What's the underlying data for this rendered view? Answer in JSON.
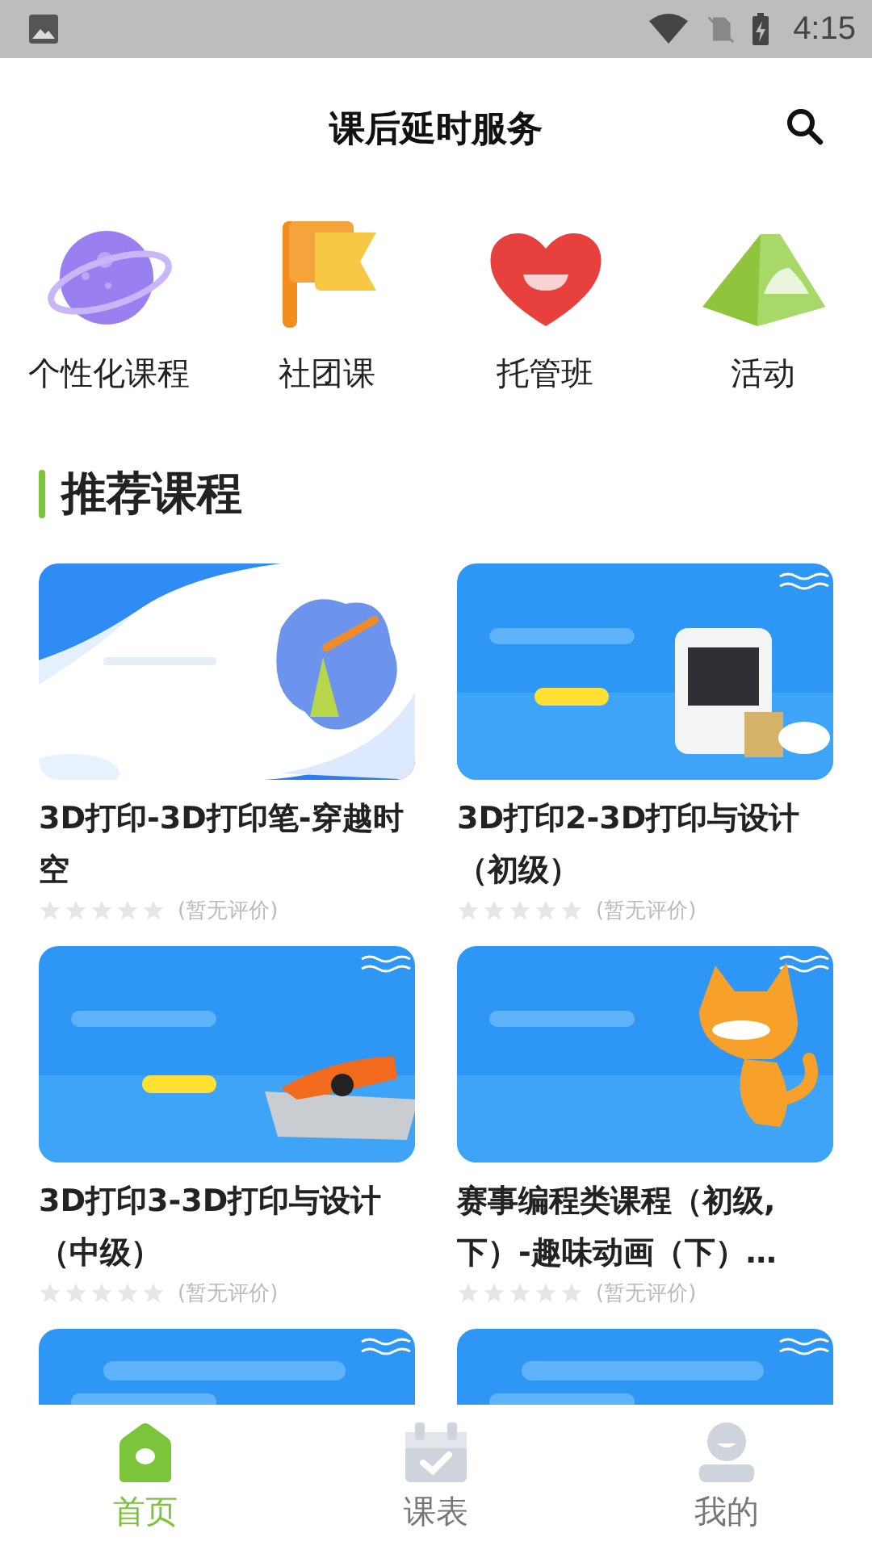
{
  "status_bar": {
    "time": "4:15"
  },
  "header": {
    "title": "课后延时服务"
  },
  "categories": [
    {
      "kind": "planet",
      "label": "个性化课程"
    },
    {
      "kind": "flag",
      "label": "社团课"
    },
    {
      "kind": "heart",
      "label": "托管班"
    },
    {
      "kind": "tent",
      "label": "活动"
    }
  ],
  "section": {
    "title": "推荐课程"
  },
  "courses": [
    {
      "cover": {
        "kind": "picture"
      },
      "title": "3D打印-3D打印笔-穿越时空",
      "stars": 0,
      "rating_text": "(暂无评价)"
    },
    {
      "cover": {
        "kind": "picture"
      },
      "title": "3D打印2-3D打印与设计（初级）",
      "stars": 0,
      "rating_text": "(暂无评价)"
    },
    {
      "cover": {
        "kind": "picture"
      },
      "title": "3D打印3-3D打印与设计（中级）",
      "stars": 0,
      "rating_text": "(暂无评价)"
    },
    {
      "cover": {
        "kind": "picture"
      },
      "title": "赛事编程类课程（初级,下）-趣味动画（下）…",
      "stars": 0,
      "rating_text": "(暂无评价)"
    },
    {
      "cover": {
        "kind": "picture"
      }
    },
    {
      "cover": {
        "kind": "picture"
      }
    }
  ],
  "tabs": [
    {
      "kind": "home",
      "label": "首页",
      "selected": true
    },
    {
      "kind": "calendar",
      "label": "课表",
      "selected": false
    },
    {
      "kind": "person",
      "label": "我的",
      "selected": false
    }
  ]
}
